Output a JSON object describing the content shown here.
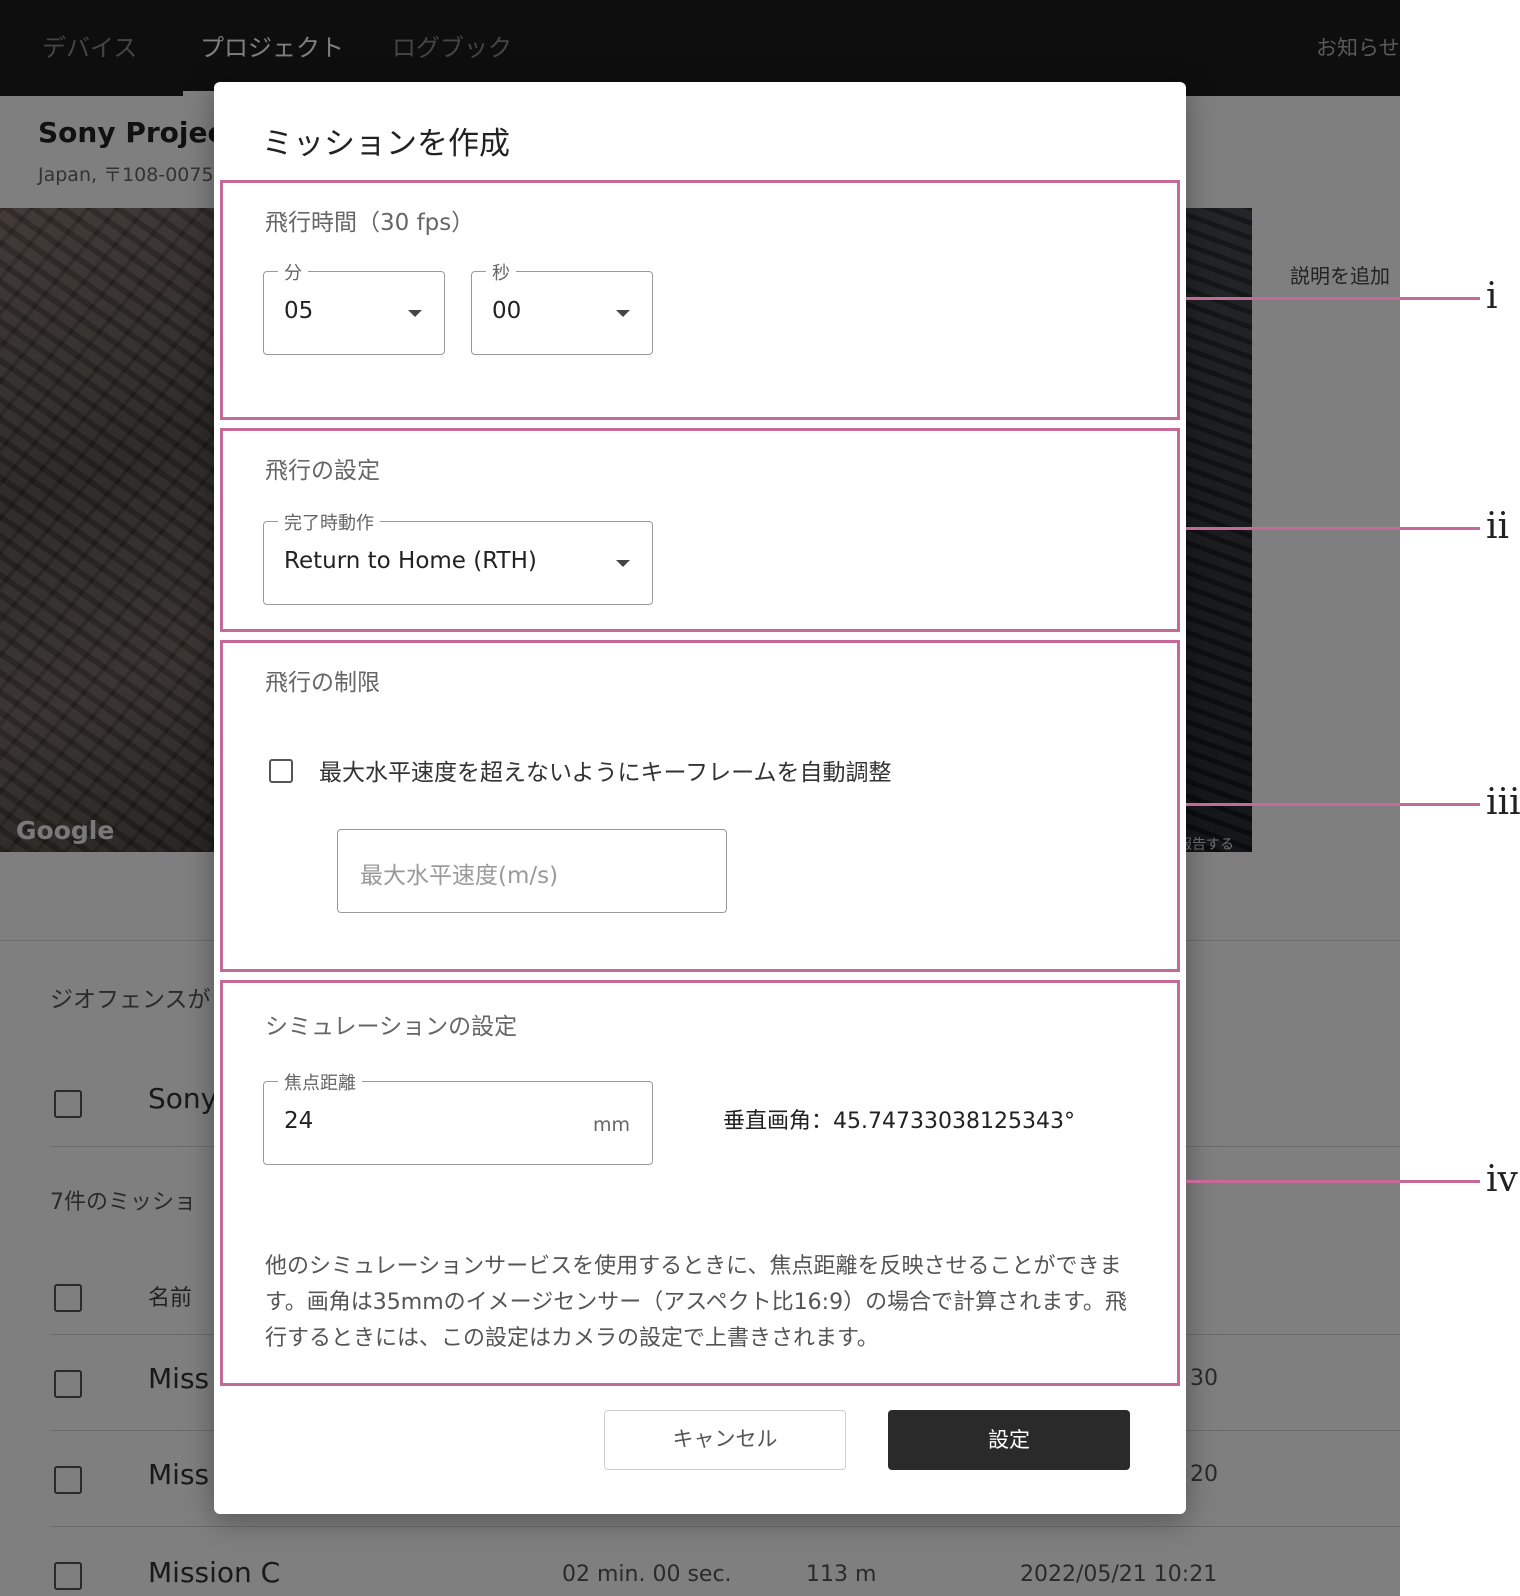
{
  "nav": {
    "items": [
      "デバイス",
      "プロジェクト",
      "ログブック"
    ],
    "notice": "お知らせ"
  },
  "project": {
    "title": "Sony Project",
    "address": "Japan, 〒108-0075"
  },
  "map": {
    "attribution": "Google",
    "report": "報告する"
  },
  "background": {
    "add_description": "説明を追加",
    "geofence_label": "ジオフェンスが",
    "sony_row": "Sony",
    "mission_count": "7件のミッショ",
    "name_header": "名前",
    "rows": [
      {
        "name": "Miss",
        "date_tail": "30"
      },
      {
        "name": "Miss",
        "date_tail": "20"
      },
      {
        "name": "Mission C",
        "duration": "02 min. 00 sec.",
        "distance": "113 m",
        "date": "2022/05/21 10:21"
      }
    ]
  },
  "dialog": {
    "title": "ミッションを作成",
    "flight_time": {
      "title": "飛行時間（30 fps）",
      "minutes": {
        "label": "分",
        "value": "05"
      },
      "seconds": {
        "label": "秒",
        "value": "00"
      }
    },
    "flight_settings": {
      "title": "飛行の設定",
      "completion": {
        "label": "完了時動作",
        "value": "Return to Home (RTH)"
      }
    },
    "flight_limits": {
      "title": "飛行の制限",
      "auto_adjust_label": "最大水平速度を超えないようにキーフレームを自動調整",
      "auto_adjust_checked": false,
      "max_speed_placeholder": "最大水平速度(m/s)"
    },
    "simulation": {
      "title": "シミュレーションの設定",
      "focal_length": {
        "label": "焦点距離",
        "value": "24",
        "unit": "mm"
      },
      "vertical_angle": "垂直画角：45.74733038125343°",
      "help": "他のシミュレーションサービスを使用するときに、焦点距離を反映させることができます。画角は35mmのイメージセンサー（アスペクト比16:9）の場合で計算されます。飛行するときには、この設定はカメラの設定で上書きされます。"
    },
    "cancel_label": "キャンセル",
    "ok_label": "設定"
  },
  "callouts": [
    "i",
    "ii",
    "iii",
    "iv"
  ],
  "colors": {
    "callout": "#c56a98",
    "primary_button": "#2a2a2a",
    "nav_background": "#1c1c1c"
  }
}
